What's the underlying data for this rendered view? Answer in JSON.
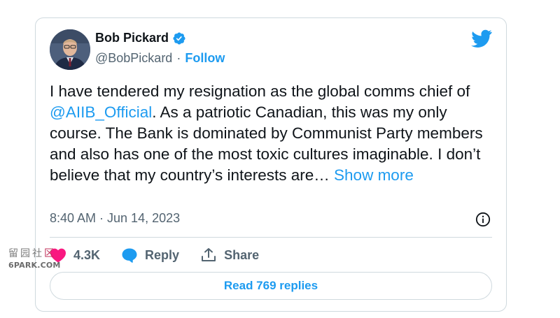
{
  "tweet": {
    "author_name": "Bob Pickard",
    "handle": "@BobPickard",
    "separator": "·",
    "follow_label": "Follow",
    "text_part1": "I have tendered my resignation as the global comms chief of ",
    "mention": "@AIIB_Official",
    "text_part2": ". As a patriotic Canadian, this was my only course. The Bank is dominated by Communist Party members and also has one of the most toxic cultures imaginable. I don’t believe that my country’s interests are…",
    "show_more_label": "Show more",
    "timestamp": "8:40 AM · Jun 14, 2023"
  },
  "actions": {
    "likes_count": "4.3K",
    "reply_label": "Reply",
    "share_label": "Share"
  },
  "read_replies_label": "Read 769 replies",
  "watermark": {
    "chars": [
      "留",
      "园",
      "社",
      "区"
    ],
    "url": "6PARK.COM"
  },
  "colors": {
    "accent": "#1d9bf0",
    "like_heart": "#f91880",
    "text_primary": "#0f1419",
    "text_secondary": "#536471",
    "border": "#cfd9de"
  },
  "icons": [
    "verified-badge-icon",
    "twitter-bird-icon",
    "info-icon",
    "heart-icon",
    "reply-bubble-icon",
    "share-icon"
  ]
}
